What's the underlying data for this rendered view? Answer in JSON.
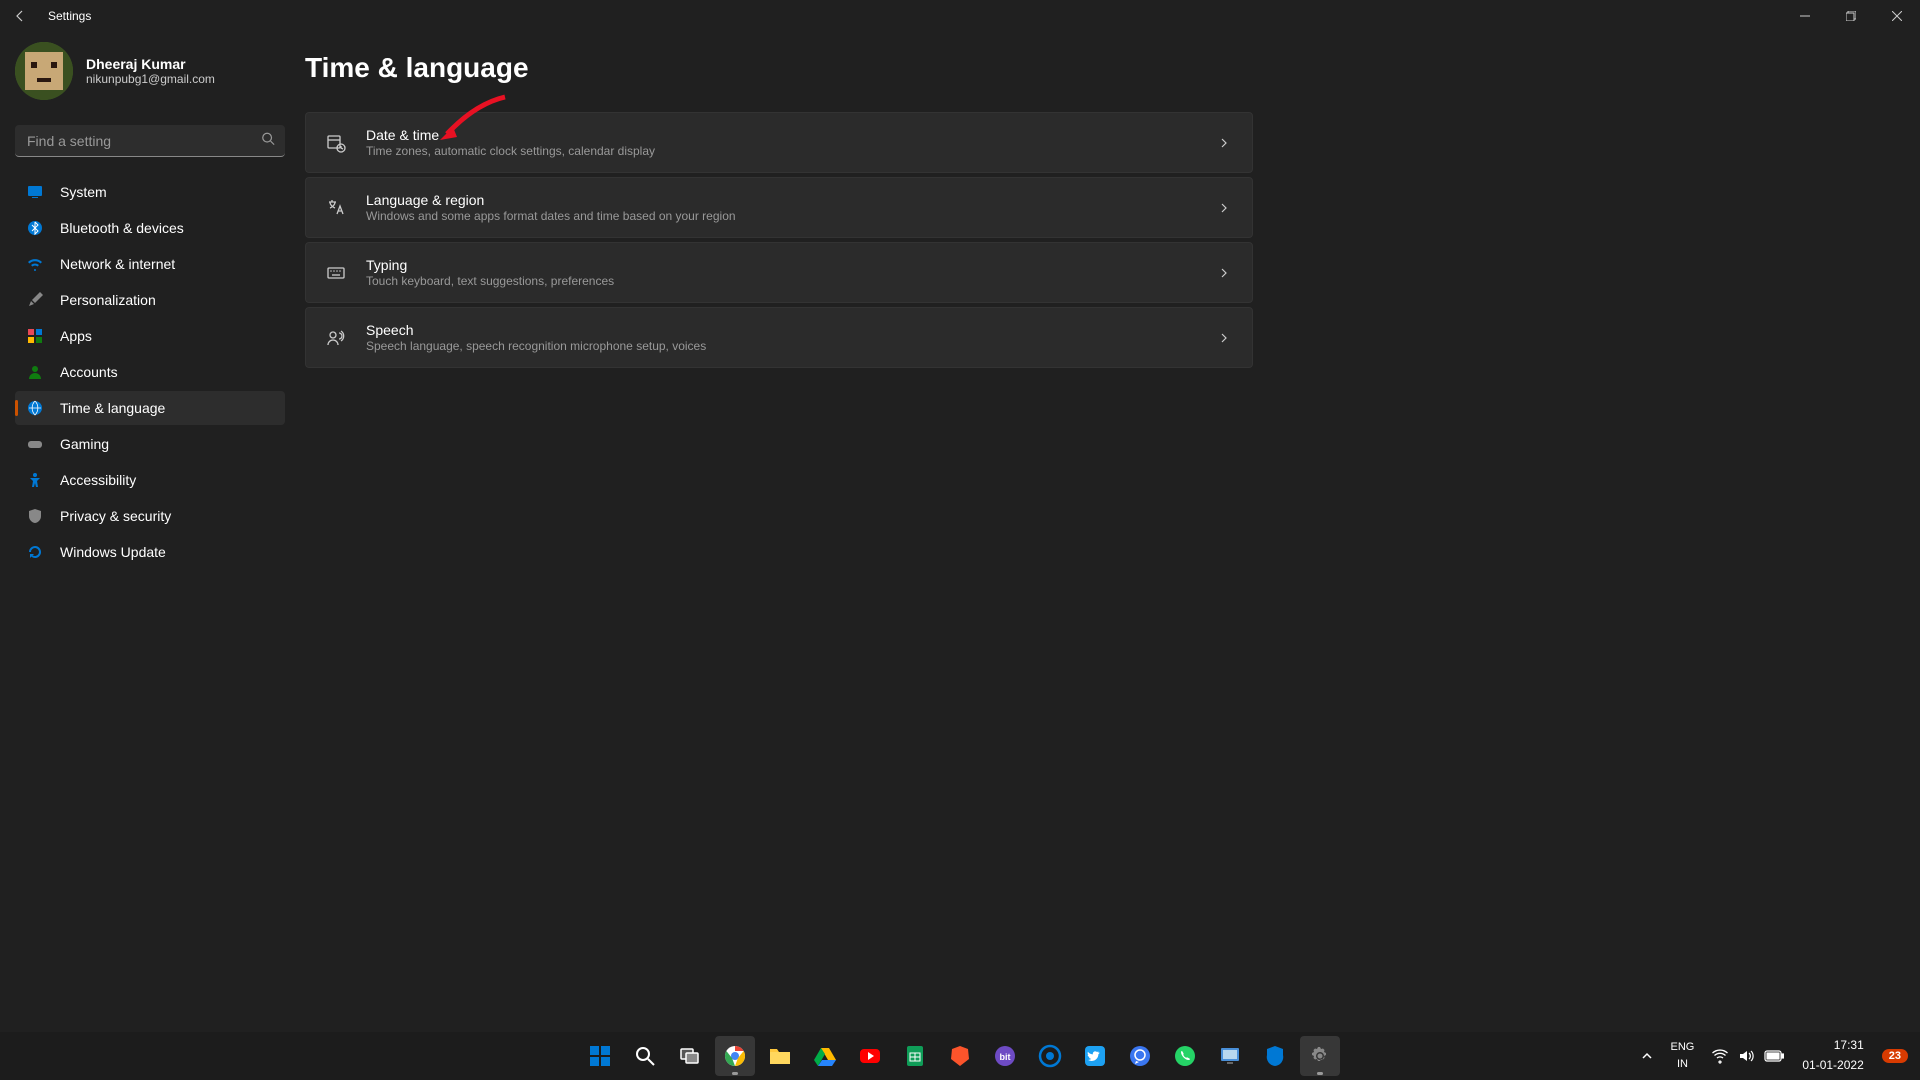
{
  "window": {
    "title": "Settings"
  },
  "profile": {
    "name": "Dheeraj Kumar",
    "email": "nikunpubg1@gmail.com"
  },
  "search": {
    "placeholder": "Find a setting"
  },
  "nav": [
    {
      "label": "System",
      "icon": "monitor",
      "active": false
    },
    {
      "label": "Bluetooth & devices",
      "icon": "bluetooth",
      "active": false
    },
    {
      "label": "Network & internet",
      "icon": "wifi",
      "active": false
    },
    {
      "label": "Personalization",
      "icon": "brush",
      "active": false
    },
    {
      "label": "Apps",
      "icon": "apps",
      "active": false
    },
    {
      "label": "Accounts",
      "icon": "person",
      "active": false
    },
    {
      "label": "Time & language",
      "icon": "clock-globe",
      "active": true
    },
    {
      "label": "Gaming",
      "icon": "gamepad",
      "active": false
    },
    {
      "label": "Accessibility",
      "icon": "accessibility",
      "active": false
    },
    {
      "label": "Privacy & security",
      "icon": "shield",
      "active": false
    },
    {
      "label": "Windows Update",
      "icon": "update",
      "active": false
    }
  ],
  "page": {
    "title": "Time & language",
    "cards": [
      {
        "title": "Date & time",
        "subtitle": "Time zones, automatic clock settings, calendar display",
        "icon": "calendar-clock"
      },
      {
        "title": "Language & region",
        "subtitle": "Windows and some apps format dates and time based on your region",
        "icon": "language"
      },
      {
        "title": "Typing",
        "subtitle": "Touch keyboard, text suggestions, preferences",
        "icon": "keyboard"
      },
      {
        "title": "Speech",
        "subtitle": "Speech language, speech recognition microphone setup, voices",
        "icon": "speech"
      }
    ]
  },
  "taskbar": {
    "apps": [
      {
        "name": "start",
        "color": "#0078d4"
      },
      {
        "name": "search",
        "color": "#ffffff"
      },
      {
        "name": "task-view",
        "color": "#ffffff"
      },
      {
        "name": "chrome",
        "color": "#ffffff"
      },
      {
        "name": "explorer",
        "color": "#ffc83d"
      },
      {
        "name": "drive",
        "color": "#0f9d58"
      },
      {
        "name": "youtube",
        "color": "#ff0000"
      },
      {
        "name": "sheets",
        "color": "#0f9d58"
      },
      {
        "name": "brave",
        "color": "#fb542b"
      },
      {
        "name": "bit",
        "color": "#6e4bc4"
      },
      {
        "name": "coda",
        "color": "#0078d4"
      },
      {
        "name": "twitter",
        "color": "#1da1f2"
      },
      {
        "name": "signal",
        "color": "#3a76f0"
      },
      {
        "name": "whatsapp",
        "color": "#25d366"
      },
      {
        "name": "monitor-app",
        "color": "#0078d4"
      },
      {
        "name": "security",
        "color": "#0078d4"
      },
      {
        "name": "settings",
        "color": "#888888"
      }
    ],
    "tray": {
      "lang_top": "ENG",
      "lang_bottom": "IN",
      "time": "17:31",
      "date": "01-01-2022",
      "notif_count": "23"
    }
  }
}
